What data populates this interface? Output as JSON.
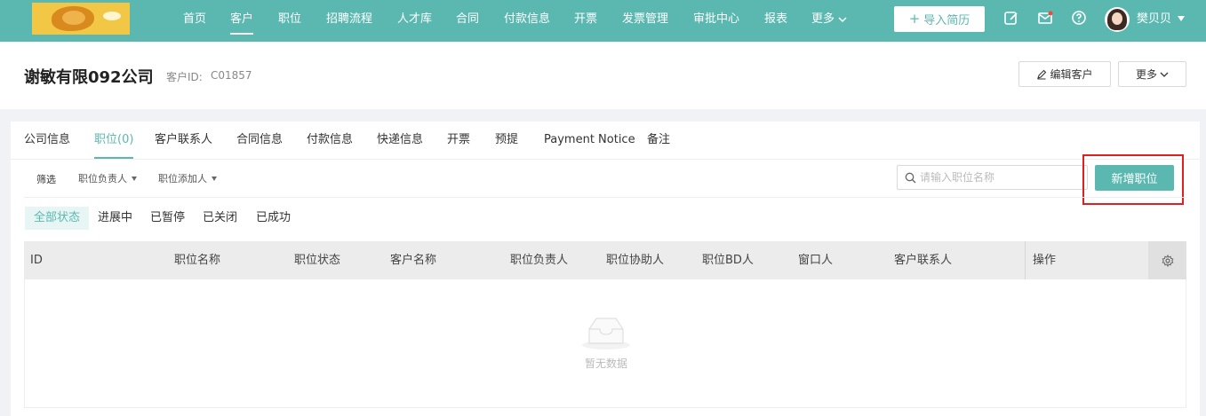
{
  "nav": {
    "items": [
      {
        "label": "首页",
        "active": false
      },
      {
        "label": "客户",
        "active": true
      },
      {
        "label": "职位",
        "active": false
      },
      {
        "label": "招聘流程",
        "active": false
      },
      {
        "label": "人才库",
        "active": false
      },
      {
        "label": "合同",
        "active": false
      },
      {
        "label": "付款信息",
        "active": false
      },
      {
        "label": "开票",
        "active": false
      },
      {
        "label": "发票管理",
        "active": false
      },
      {
        "label": "审批中心",
        "active": false
      },
      {
        "label": "报表",
        "active": false
      },
      {
        "label": "更多",
        "active": false
      }
    ],
    "import_button": "导入简历",
    "user_name": "樊贝贝"
  },
  "header": {
    "company_name": "谢敏有限092公司",
    "customer_id_label": "客户ID:",
    "customer_id_value": "C01857",
    "edit_button": "编辑客户",
    "more_button": "更多"
  },
  "tabs": [
    {
      "label": "公司信息",
      "active": false
    },
    {
      "label": "职位(0)",
      "active": true
    },
    {
      "label": "客户联系人",
      "active": false
    },
    {
      "label": "合同信息",
      "active": false
    },
    {
      "label": "付款信息",
      "active": false
    },
    {
      "label": "快递信息",
      "active": false
    },
    {
      "label": "开票",
      "active": false
    },
    {
      "label": "预提",
      "active": false
    },
    {
      "label": "Payment Notice",
      "active": false
    },
    {
      "label": "备注",
      "active": false
    }
  ],
  "filters": {
    "label": "筛选",
    "owner": "职位负责人",
    "adder": "职位添加人"
  },
  "search": {
    "placeholder": "请输入职位名称",
    "value": ""
  },
  "add_position_button": "新增职位",
  "status_filters": [
    {
      "label": "全部状态",
      "active": true
    },
    {
      "label": "进展中",
      "active": false
    },
    {
      "label": "已暂停",
      "active": false
    },
    {
      "label": "已关闭",
      "active": false
    },
    {
      "label": "已成功",
      "active": false
    }
  ],
  "table": {
    "columns": [
      "ID",
      "职位名称",
      "职位状态",
      "客户名称",
      "职位负责人",
      "职位协助人",
      "职位BD人",
      "窗口人",
      "客户联系人",
      "操作"
    ],
    "rows": [],
    "empty_text": "暂无数据"
  },
  "colors": {
    "primary": "#5bb8b1",
    "highlight": "#e02020"
  }
}
